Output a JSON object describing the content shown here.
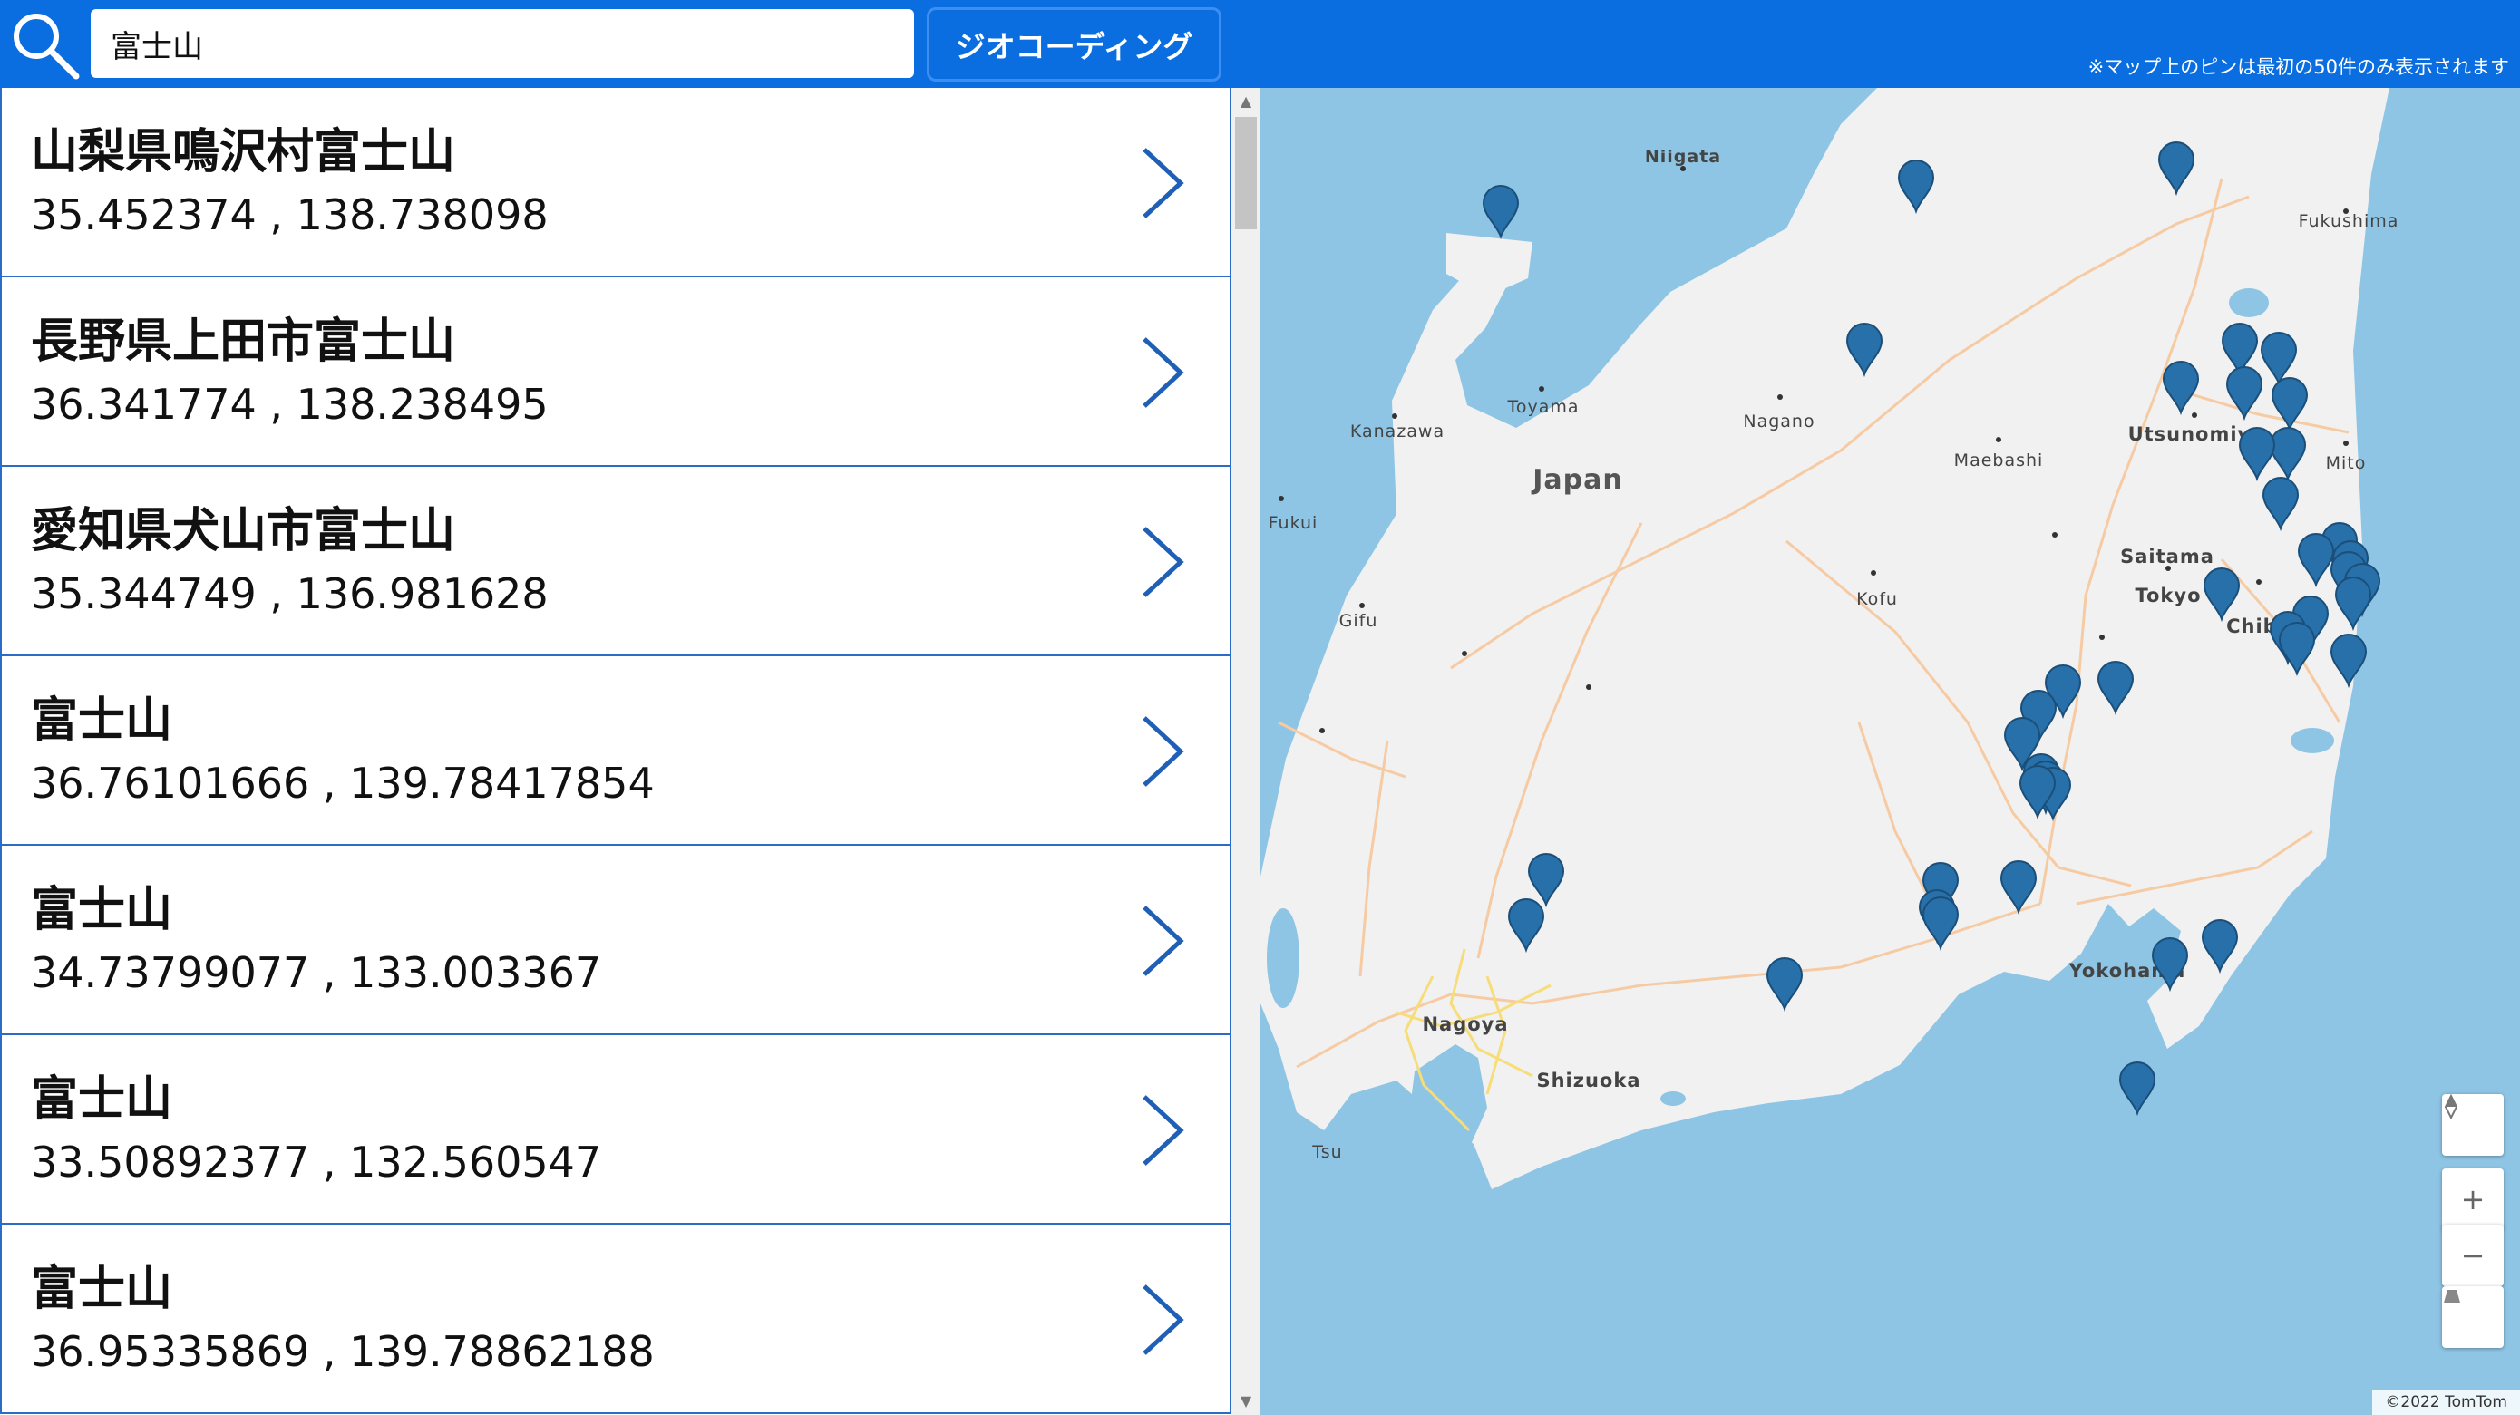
{
  "search": {
    "value": "富士山",
    "button_label": "ジオコーディング",
    "note": "※マップ上のピンは最初の50件のみ表示されます"
  },
  "results": [
    {
      "name": "山梨県鳴沢村富士山",
      "coords": "35.452374 , 138.738098"
    },
    {
      "name": "長野県上田市富士山",
      "coords": "36.341774 , 138.238495"
    },
    {
      "name": "愛知県犬山市富士山",
      "coords": "35.344749 , 136.981628"
    },
    {
      "name": "富士山",
      "coords": "36.76101666 , 139.78417854"
    },
    {
      "name": "富士山",
      "coords": "34.73799077 , 133.003367"
    },
    {
      "name": "富士山",
      "coords": "33.50892377 , 132.560547"
    },
    {
      "name": "富士山",
      "coords": "36.95335869 , 139.78862188"
    }
  ],
  "map": {
    "labels": {
      "niigata": "Niigata",
      "fukushima": "Fukushima",
      "toyama": "Toyama",
      "nagano": "Nagano",
      "kanazawa": "Kanazawa",
      "utsunomiya": "Utsunomiya",
      "maebashi": "Maebashi",
      "mito": "Mito",
      "japan": "Japan",
      "fukui": "Fukui",
      "saitama": "Saitama",
      "tokyo": "Tokyo",
      "kofu": "Kofu",
      "chiba": "Chiba",
      "gifu": "Gifu",
      "yokohama": "Yokohama",
      "nagoya": "Nagoya",
      "shizuoka": "Shizuoka",
      "tsu": "Tsu"
    },
    "controls": {
      "compass": "north-arrow-icon",
      "zoom_in": "+",
      "zoom_out": "−",
      "pitch": "pitch-icon"
    },
    "copyright": "©2022 TomTom",
    "colors": {
      "water": "#8ec5e5",
      "land": "#f1f1f1",
      "pin": "#2870a9",
      "topbar": "#0a6ee0"
    }
  }
}
